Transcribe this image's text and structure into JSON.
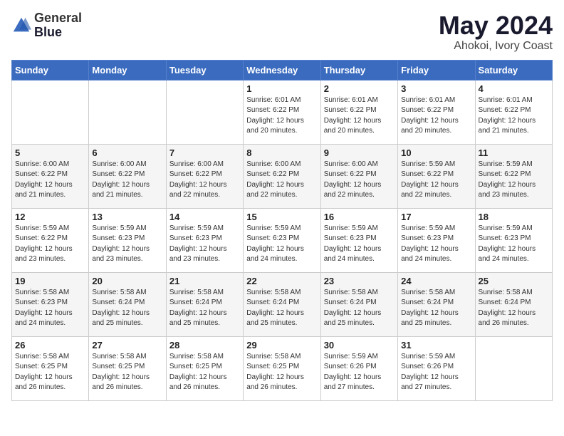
{
  "logo": {
    "line1": "General",
    "line2": "Blue"
  },
  "calendar": {
    "month": "May 2024",
    "location": "Ahokoi, Ivory Coast",
    "days_of_week": [
      "Sunday",
      "Monday",
      "Tuesday",
      "Wednesday",
      "Thursday",
      "Friday",
      "Saturday"
    ],
    "weeks": [
      [
        {
          "day": "",
          "info": ""
        },
        {
          "day": "",
          "info": ""
        },
        {
          "day": "",
          "info": ""
        },
        {
          "day": "1",
          "info": "Sunrise: 6:01 AM\nSunset: 6:22 PM\nDaylight: 12 hours\nand 20 minutes."
        },
        {
          "day": "2",
          "info": "Sunrise: 6:01 AM\nSunset: 6:22 PM\nDaylight: 12 hours\nand 20 minutes."
        },
        {
          "day": "3",
          "info": "Sunrise: 6:01 AM\nSunset: 6:22 PM\nDaylight: 12 hours\nand 20 minutes."
        },
        {
          "day": "4",
          "info": "Sunrise: 6:01 AM\nSunset: 6:22 PM\nDaylight: 12 hours\nand 21 minutes."
        }
      ],
      [
        {
          "day": "5",
          "info": "Sunrise: 6:00 AM\nSunset: 6:22 PM\nDaylight: 12 hours\nand 21 minutes."
        },
        {
          "day": "6",
          "info": "Sunrise: 6:00 AM\nSunset: 6:22 PM\nDaylight: 12 hours\nand 21 minutes."
        },
        {
          "day": "7",
          "info": "Sunrise: 6:00 AM\nSunset: 6:22 PM\nDaylight: 12 hours\nand 22 minutes."
        },
        {
          "day": "8",
          "info": "Sunrise: 6:00 AM\nSunset: 6:22 PM\nDaylight: 12 hours\nand 22 minutes."
        },
        {
          "day": "9",
          "info": "Sunrise: 6:00 AM\nSunset: 6:22 PM\nDaylight: 12 hours\nand 22 minutes."
        },
        {
          "day": "10",
          "info": "Sunrise: 5:59 AM\nSunset: 6:22 PM\nDaylight: 12 hours\nand 22 minutes."
        },
        {
          "day": "11",
          "info": "Sunrise: 5:59 AM\nSunset: 6:22 PM\nDaylight: 12 hours\nand 23 minutes."
        }
      ],
      [
        {
          "day": "12",
          "info": "Sunrise: 5:59 AM\nSunset: 6:22 PM\nDaylight: 12 hours\nand 23 minutes."
        },
        {
          "day": "13",
          "info": "Sunrise: 5:59 AM\nSunset: 6:23 PM\nDaylight: 12 hours\nand 23 minutes."
        },
        {
          "day": "14",
          "info": "Sunrise: 5:59 AM\nSunset: 6:23 PM\nDaylight: 12 hours\nand 23 minutes."
        },
        {
          "day": "15",
          "info": "Sunrise: 5:59 AM\nSunset: 6:23 PM\nDaylight: 12 hours\nand 24 minutes."
        },
        {
          "day": "16",
          "info": "Sunrise: 5:59 AM\nSunset: 6:23 PM\nDaylight: 12 hours\nand 24 minutes."
        },
        {
          "day": "17",
          "info": "Sunrise: 5:59 AM\nSunset: 6:23 PM\nDaylight: 12 hours\nand 24 minutes."
        },
        {
          "day": "18",
          "info": "Sunrise: 5:59 AM\nSunset: 6:23 PM\nDaylight: 12 hours\nand 24 minutes."
        }
      ],
      [
        {
          "day": "19",
          "info": "Sunrise: 5:58 AM\nSunset: 6:23 PM\nDaylight: 12 hours\nand 24 minutes."
        },
        {
          "day": "20",
          "info": "Sunrise: 5:58 AM\nSunset: 6:24 PM\nDaylight: 12 hours\nand 25 minutes."
        },
        {
          "day": "21",
          "info": "Sunrise: 5:58 AM\nSunset: 6:24 PM\nDaylight: 12 hours\nand 25 minutes."
        },
        {
          "day": "22",
          "info": "Sunrise: 5:58 AM\nSunset: 6:24 PM\nDaylight: 12 hours\nand 25 minutes."
        },
        {
          "day": "23",
          "info": "Sunrise: 5:58 AM\nSunset: 6:24 PM\nDaylight: 12 hours\nand 25 minutes."
        },
        {
          "day": "24",
          "info": "Sunrise: 5:58 AM\nSunset: 6:24 PM\nDaylight: 12 hours\nand 25 minutes."
        },
        {
          "day": "25",
          "info": "Sunrise: 5:58 AM\nSunset: 6:24 PM\nDaylight: 12 hours\nand 26 minutes."
        }
      ],
      [
        {
          "day": "26",
          "info": "Sunrise: 5:58 AM\nSunset: 6:25 PM\nDaylight: 12 hours\nand 26 minutes."
        },
        {
          "day": "27",
          "info": "Sunrise: 5:58 AM\nSunset: 6:25 PM\nDaylight: 12 hours\nand 26 minutes."
        },
        {
          "day": "28",
          "info": "Sunrise: 5:58 AM\nSunset: 6:25 PM\nDaylight: 12 hours\nand 26 minutes."
        },
        {
          "day": "29",
          "info": "Sunrise: 5:58 AM\nSunset: 6:25 PM\nDaylight: 12 hours\nand 26 minutes."
        },
        {
          "day": "30",
          "info": "Sunrise: 5:59 AM\nSunset: 6:26 PM\nDaylight: 12 hours\nand 27 minutes."
        },
        {
          "day": "31",
          "info": "Sunrise: 5:59 AM\nSunset: 6:26 PM\nDaylight: 12 hours\nand 27 minutes."
        },
        {
          "day": "",
          "info": ""
        }
      ]
    ]
  }
}
